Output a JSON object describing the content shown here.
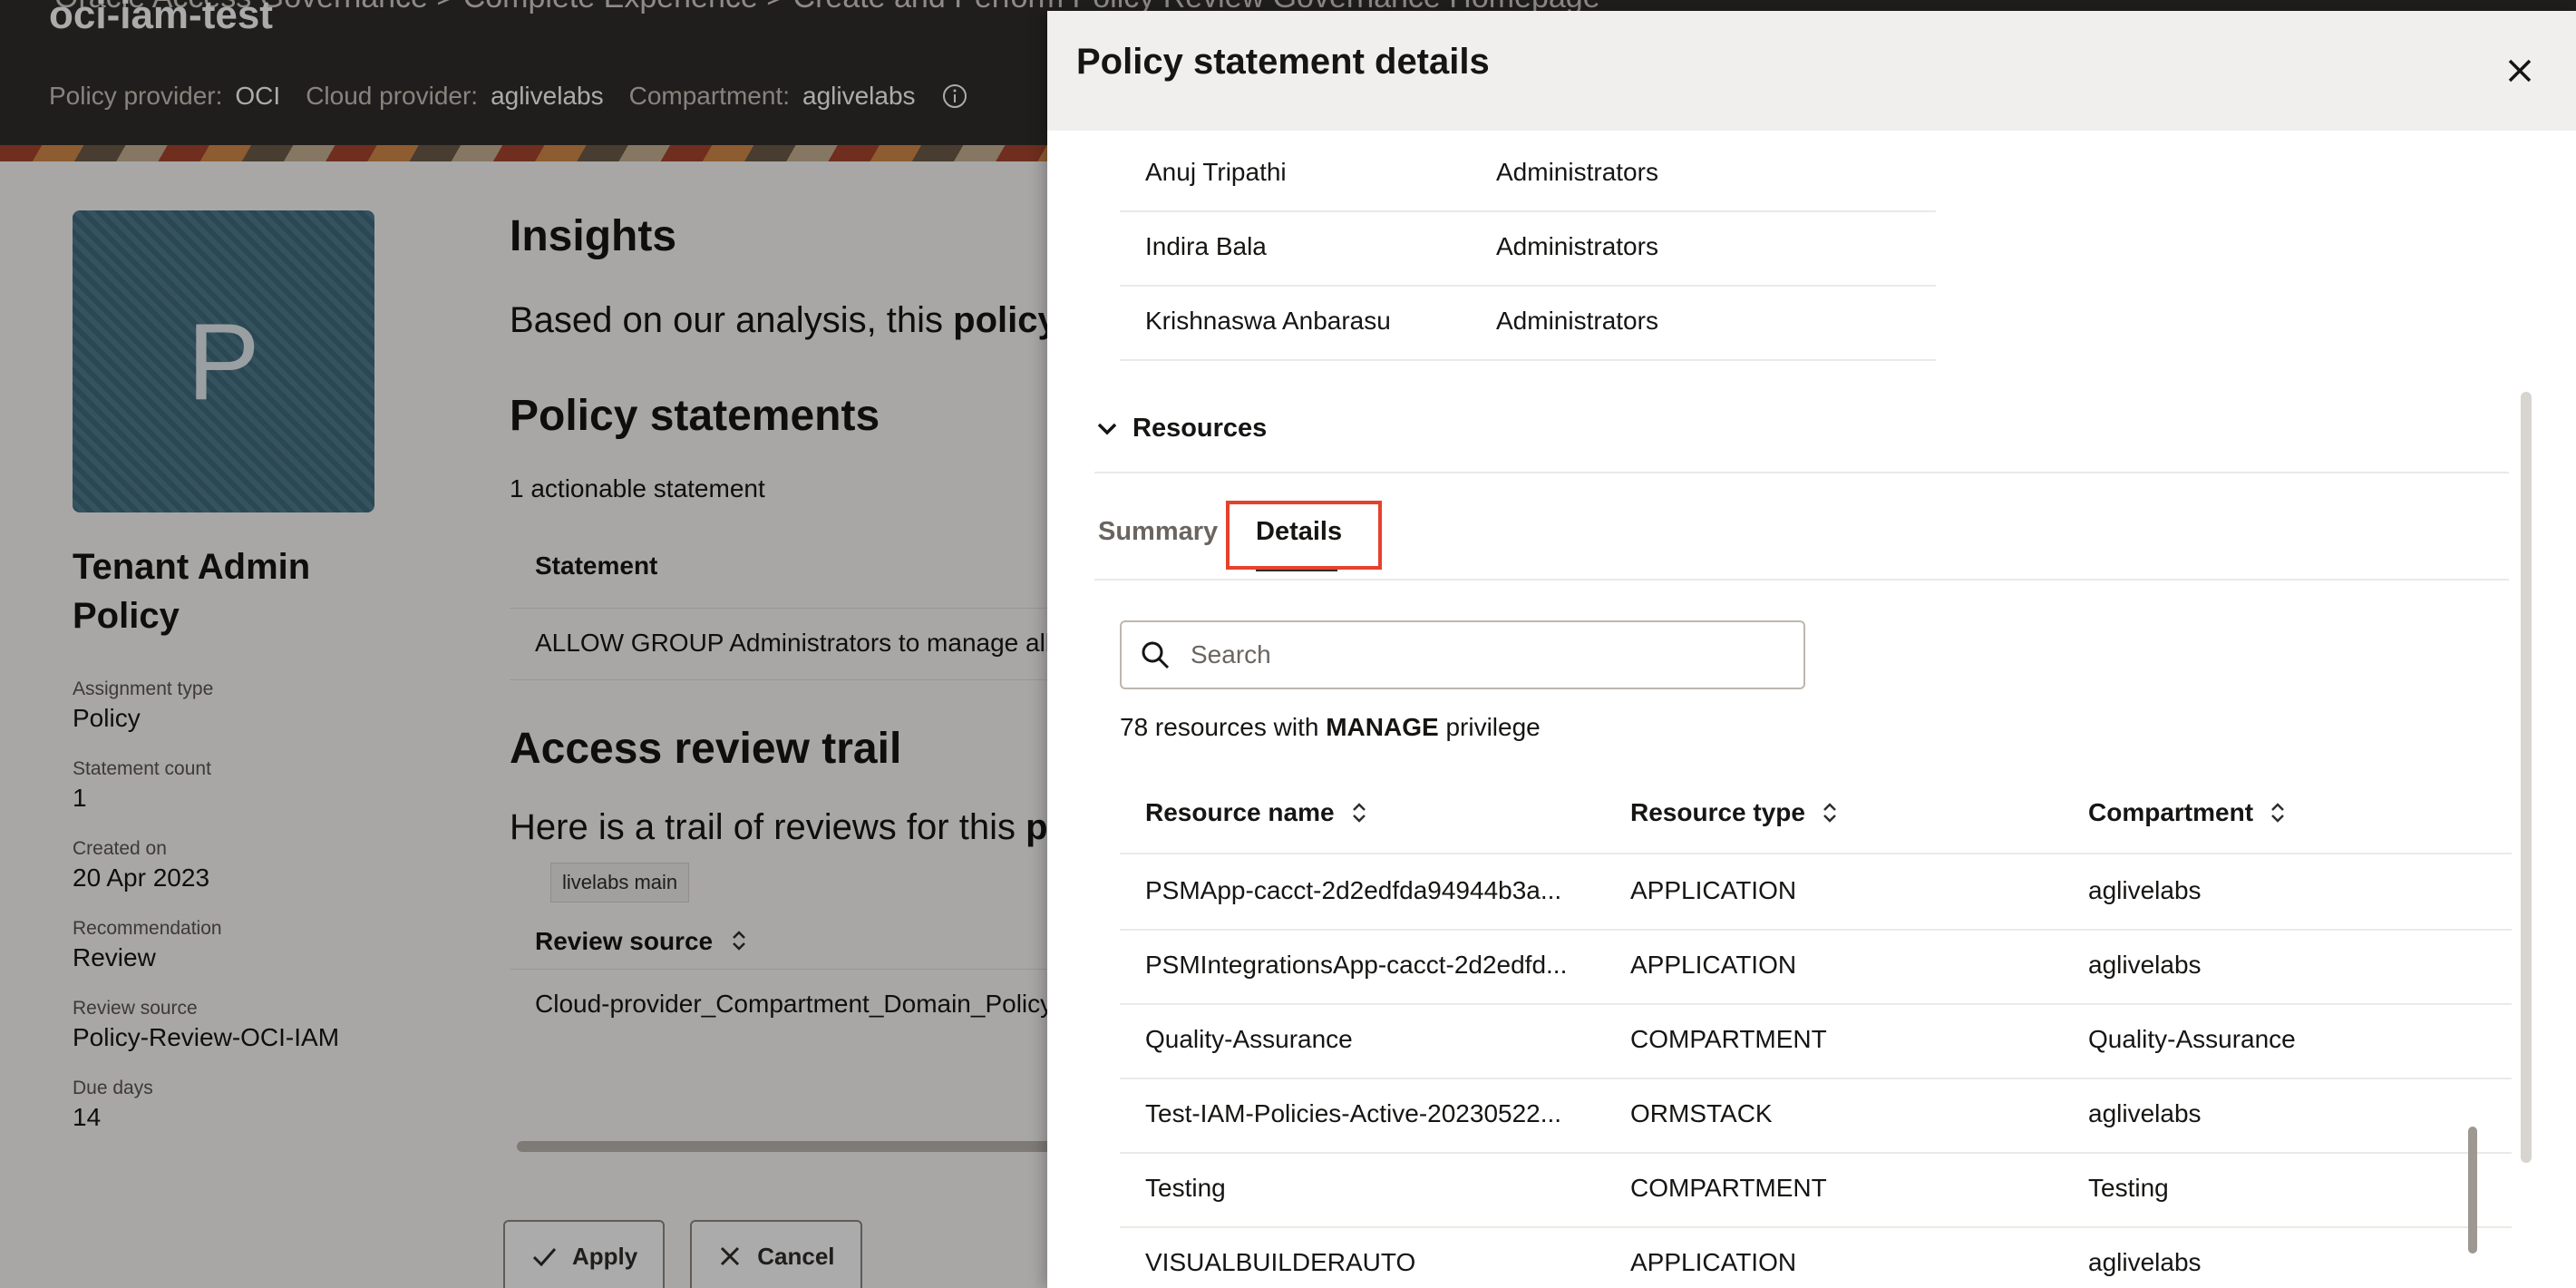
{
  "page": {
    "breadcrumb": "Oracle Access Governance > Complete Experience > Create and Perform Policy Review Governance Homepage",
    "title": "oci-iam-test",
    "meta": [
      {
        "label": "Policy provider:",
        "value": "OCI"
      },
      {
        "label": "Cloud provider:",
        "value": "aglivelabs"
      },
      {
        "label": "Compartment:",
        "value": "aglivelabs"
      }
    ]
  },
  "sidebar": {
    "avatar_letter": "P",
    "policy_name": "Tenant Admin Policy",
    "attributes": [
      {
        "key": "Assignment type",
        "value": "Policy"
      },
      {
        "key": "Statement count",
        "value": "1"
      },
      {
        "key": "Created on",
        "value": "20 Apr 2023"
      },
      {
        "key": "Recommendation",
        "value": "Review"
      },
      {
        "key": "Review source",
        "value": "Policy-Review-OCI-IAM"
      },
      {
        "key": "Due days",
        "value": "14"
      }
    ]
  },
  "main": {
    "insights_heading": "Insights",
    "insight_prefix": "Based on our analysis, this ",
    "insight_bold": "policy",
    "statements_heading": "Policy statements",
    "actionable": "1 actionable statement",
    "statement_col": "Statement",
    "statement_value": "ALLOW GROUP Administrators to manage all-",
    "trail_heading": "Access review trail",
    "trail_prefix": "Here is a trail of reviews for this ",
    "trail_bold": "po",
    "tooltip": "livelabs main",
    "review_source_col": "Review source",
    "review_source_value": "Cloud-provider_Compartment_Domain_Policy",
    "apply_label": "Apply",
    "cancel_label": "Cancel"
  },
  "drawer": {
    "title": "Policy statement details",
    "members": [
      {
        "name": "Anuj Tripathi",
        "group": "Administrators"
      },
      {
        "name": "Indira Bala",
        "group": "Administrators"
      },
      {
        "name": "Krishnaswa Anbarasu",
        "group": "Administrators"
      }
    ],
    "resources_label": "Resources",
    "tabs": {
      "summary": "Summary",
      "details": "Details"
    },
    "search_placeholder": "Search",
    "count_prefix": "78 resources with ",
    "count_bold": "MANAGE",
    "count_suffix": " privilege",
    "columns": {
      "name": "Resource name",
      "type": "Resource type",
      "compartment": "Compartment"
    },
    "rows": [
      {
        "name": "PSMApp-cacct-2d2edfda94944b3a...",
        "type": "APPLICATION",
        "compartment": "aglivelabs"
      },
      {
        "name": "PSMIntegrationsApp-cacct-2d2edfd...",
        "type": "APPLICATION",
        "compartment": "aglivelabs"
      },
      {
        "name": "Quality-Assurance",
        "type": "COMPARTMENT",
        "compartment": "Quality-Assurance"
      },
      {
        "name": "Test-IAM-Policies-Active-20230522...",
        "type": "ORMSTACK",
        "compartment": "aglivelabs"
      },
      {
        "name": "Testing",
        "type": "COMPARTMENT",
        "compartment": "Testing"
      },
      {
        "name": "VISUALBUILDERAUTO",
        "type": "APPLICATION",
        "compartment": "aglivelabs"
      }
    ]
  },
  "colors": {
    "highlight": "#e5412d",
    "header_dark": "#312d2a",
    "drawer_header": "#f1efed"
  }
}
